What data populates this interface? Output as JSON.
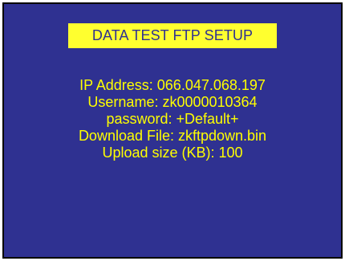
{
  "title": "DATA TEST FTP SETUP",
  "lines": [
    "IP Address: 066.047.068.197",
    "Username: zk0000010364",
    "password: +Default+",
    "Download File: zkftpdown.bin",
    "Upload size (KB): 100"
  ],
  "colors": {
    "background": "#2f3191",
    "title_bg": "#ffff2f",
    "text": "#ffff00"
  }
}
